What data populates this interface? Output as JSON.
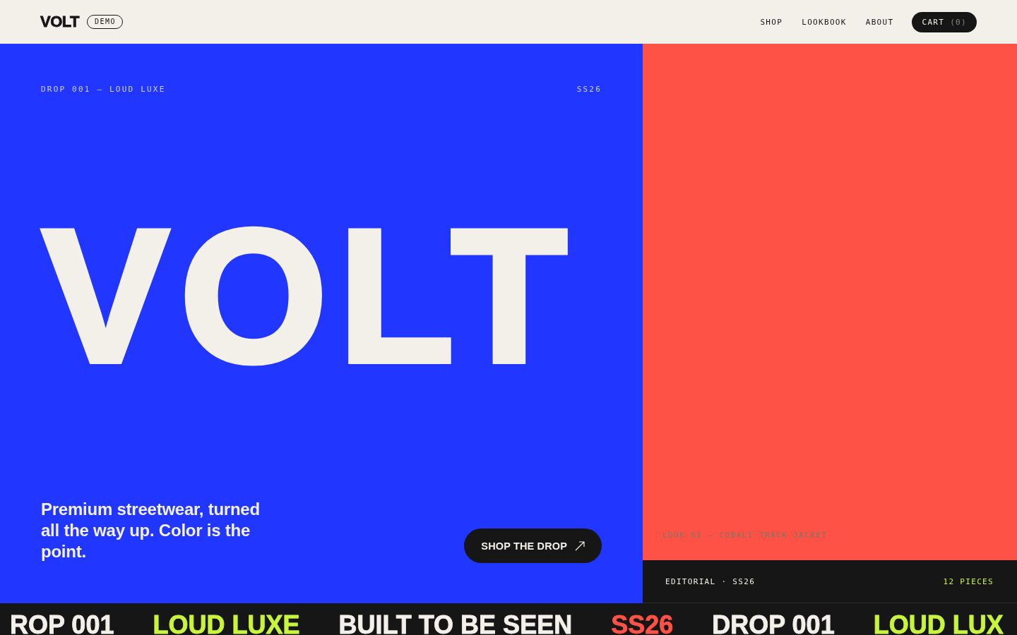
{
  "header": {
    "logo": "VOLT",
    "badge": "DEMO",
    "nav": [
      "SHOP",
      "LOOKBOOK",
      "ABOUT"
    ],
    "cart": {
      "label": "CART",
      "count": "(0)"
    }
  },
  "hero": {
    "eyebrow": "DROP 001 — LOUD LUXE",
    "season": "SS26",
    "headline": "VOLT",
    "tagline": "Premium streetwear, turned all the way up. Color is the point.",
    "cta": "SHOP THE DROP"
  },
  "look_panel": {
    "caption": "LOOK 01 — COBALT TRACK JACKET",
    "footer_left": "EDITORIAL · SS26",
    "footer_right": "12 PIECES"
  },
  "ticker": [
    {
      "text": "ROP 001",
      "color": "#f3f0e9"
    },
    {
      "text": "LOUD LUXE",
      "color": "#c8f53c"
    },
    {
      "text": "BUILT TO BE SEEN",
      "color": "#f3f0e9"
    },
    {
      "text": "SS26",
      "color": "#ff5247"
    },
    {
      "text": "DROP 001",
      "color": "#f3f0e9"
    },
    {
      "text": "LOUD LUX",
      "color": "#c8f53c"
    }
  ]
}
